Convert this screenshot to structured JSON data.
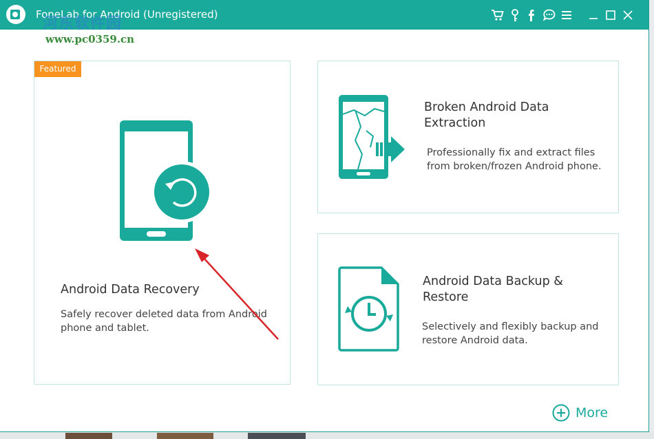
{
  "window": {
    "title": "FoneLab for Android (Unregistered)"
  },
  "watermark": {
    "site_name": "河东软件园",
    "url": "www.pc0359.cn"
  },
  "toolbar_icons": [
    "cart-icon",
    "key-icon",
    "facebook-icon",
    "chat-icon",
    "menu-icon",
    "minimize-icon",
    "maximize-icon",
    "close-icon"
  ],
  "features": {
    "recovery": {
      "badge": "Featured",
      "title": "Android Data Recovery",
      "description": "Safely recover deleted data from Android phone and tablet."
    },
    "broken": {
      "title": "Broken Android Data Extraction",
      "description": "Professionally fix and extract files from broken/frozen Android phone."
    },
    "backup": {
      "title": "Android Data Backup & Restore",
      "description": "Selectively and flexibly backup and restore Android data."
    }
  },
  "more": {
    "label": "More"
  },
  "colors": {
    "accent": "#1aaa9c",
    "badge": "#f7931e",
    "annotation_arrow": "#d9252a"
  }
}
